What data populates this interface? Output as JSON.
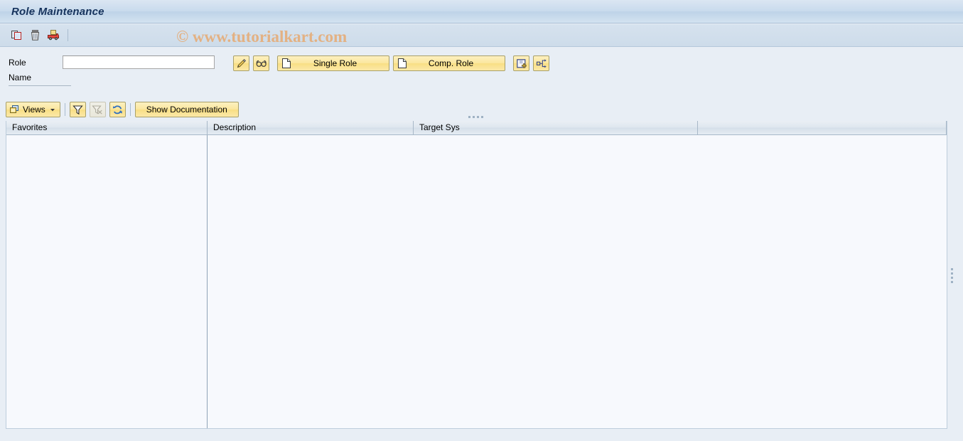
{
  "window": {
    "title": "Role Maintenance"
  },
  "watermark": {
    "text": "© www.tutorialkart.com"
  },
  "toolbar": {
    "items": [
      {
        "name": "copy-icon",
        "tooltip": "Copy Role"
      },
      {
        "name": "delete-icon",
        "tooltip": "Delete Role"
      },
      {
        "name": "transport-icon",
        "tooltip": "Transport"
      }
    ]
  },
  "form": {
    "role_label": "Role",
    "role_value": "",
    "role_placeholder": "",
    "name_label": "Name",
    "name_value": ""
  },
  "actions": {
    "change_tooltip": "Change",
    "display_tooltip": "Display",
    "single_role_label": "Single Role",
    "comp_role_label": "Comp. Role",
    "transaction_tooltip": "Transaction Inheritance",
    "derive_tooltip": "Derive Role"
  },
  "viewsbar": {
    "views_label": "Views",
    "filter_tooltip": "Set Filter",
    "filter_delete_tooltip": "Delete Filter",
    "refresh_tooltip": "Refresh",
    "show_documentation_label": "Show Documentation"
  },
  "table": {
    "columns": [
      {
        "key": "favorites",
        "label": "Favorites"
      },
      {
        "key": "description",
        "label": "Description"
      },
      {
        "key": "target_sys",
        "label": "Target Sys"
      },
      {
        "key": "blank",
        "label": ""
      }
    ],
    "rows": []
  },
  "colors": {
    "title_text": "#15325c",
    "titlebar_bg": "#c9dbed",
    "page_bg": "#e8eef5",
    "button_yellow": "#fbe79d",
    "watermark": "#e3b183",
    "table_bg": "#f7f9fd",
    "border": "#a8b8c8"
  }
}
